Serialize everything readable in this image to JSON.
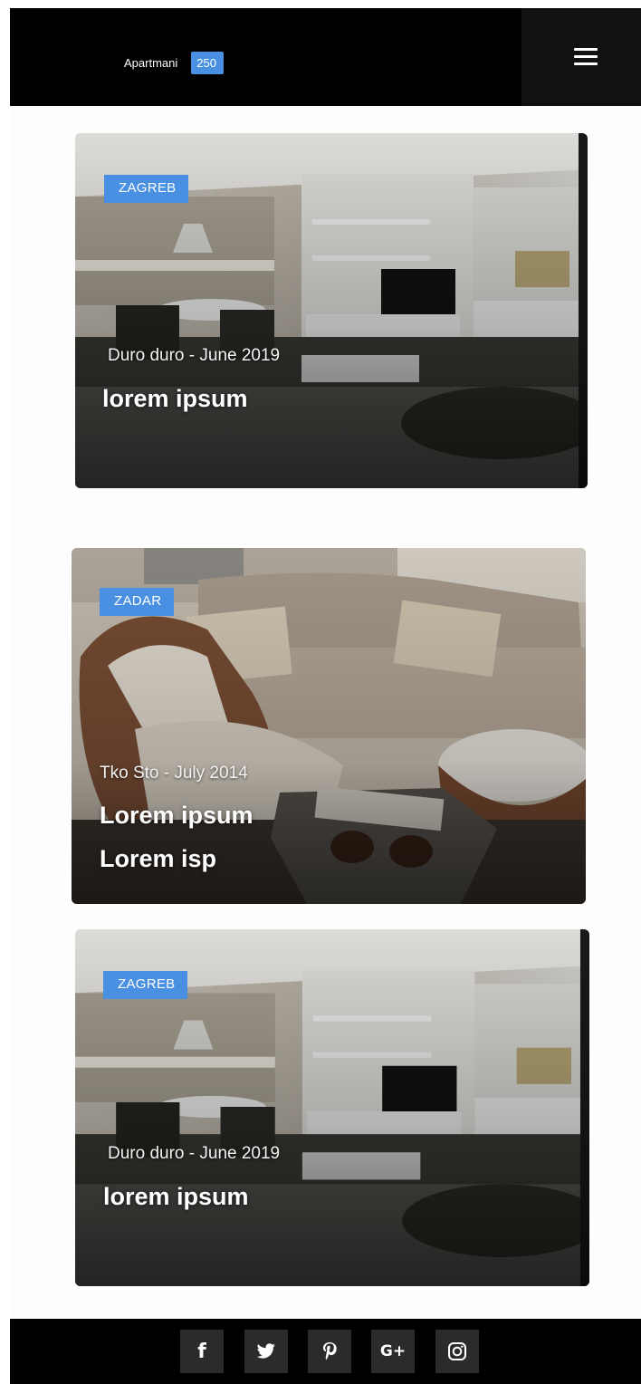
{
  "header": {
    "brand_label": "Apartmani",
    "count": "250"
  },
  "cards": [
    {
      "city": "ZAGREB",
      "meta": "Duro duro - June 2019",
      "title": "lorem ipsum"
    },
    {
      "city": "ZADAR",
      "meta": "Tko Sto - July 2014",
      "title_line1": "Lorem ipsum",
      "title_line2": "Lorem isp"
    },
    {
      "city": "ZAGREB",
      "meta": "Duro duro - June 2019",
      "title": "lorem ipsum"
    }
  ],
  "footer": {
    "social": [
      {
        "icon": "facebook-icon",
        "glyph": "f"
      },
      {
        "icon": "twitter-icon",
        "glyph": ""
      },
      {
        "icon": "pinterest-icon",
        "glyph": "p"
      },
      {
        "icon": "google-plus-icon",
        "glyph": "G+"
      },
      {
        "icon": "instagram-icon",
        "glyph": ""
      }
    ]
  },
  "colors": {
    "accent": "#4a90e2",
    "header_bg": "#000000",
    "menu_bg": "#111111",
    "footer_bg": "#000000"
  }
}
